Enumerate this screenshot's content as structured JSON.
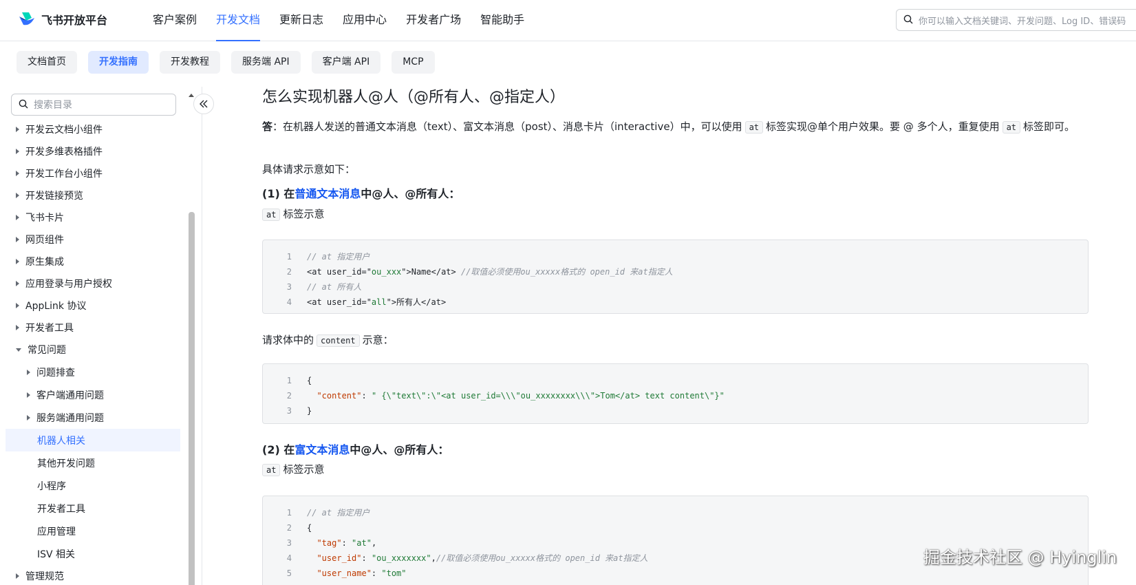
{
  "header": {
    "logo_text": "飞书开放平台",
    "nav": [
      "客户案例",
      "开发文档",
      "更新日志",
      "应用中心",
      "开发者广场",
      "智能助手"
    ],
    "active_nav": "开发文档",
    "search_placeholder": "你可以输入文档关键词、开发问题、Log ID、错误码"
  },
  "subnav": [
    "文档首页",
    "开发指南",
    "开发教程",
    "服务端 API",
    "客户端 API",
    "MCP"
  ],
  "subnav_active": "开发指南",
  "sidebar": {
    "search_placeholder": "搜索目录",
    "items": [
      {
        "label": "开发云文档小组件",
        "level": 1,
        "caret": "right"
      },
      {
        "label": "开发多维表格插件",
        "level": 1,
        "caret": "right"
      },
      {
        "label": "开发工作台小组件",
        "level": 1,
        "caret": "right"
      },
      {
        "label": "开发链接预览",
        "level": 1,
        "caret": "right"
      },
      {
        "label": "飞书卡片",
        "level": 1,
        "caret": "right"
      },
      {
        "label": "网页组件",
        "level": 1,
        "caret": "right"
      },
      {
        "label": "原生集成",
        "level": 1,
        "caret": "right"
      },
      {
        "label": "应用登录与用户授权",
        "level": 1,
        "caret": "right"
      },
      {
        "label": "AppLink 协议",
        "level": 1,
        "caret": "right"
      },
      {
        "label": "开发者工具",
        "level": 1,
        "caret": "right"
      },
      {
        "label": "常见问题",
        "level": 1,
        "caret": "down"
      },
      {
        "label": "问题排查",
        "level": 2,
        "caret": "right"
      },
      {
        "label": "客户端通用问题",
        "level": 2,
        "caret": "right"
      },
      {
        "label": "服务端通用问题",
        "level": 2,
        "caret": "right"
      },
      {
        "label": "机器人相关",
        "level": 2,
        "caret": "none",
        "selected": true
      },
      {
        "label": "其他开发问题",
        "level": 2,
        "caret": "none"
      },
      {
        "label": "小程序",
        "level": 2,
        "caret": "none"
      },
      {
        "label": "开发者工具",
        "level": 2,
        "caret": "none"
      },
      {
        "label": "应用管理",
        "level": 2,
        "caret": "none"
      },
      {
        "label": "ISV 相关",
        "level": 2,
        "caret": "none"
      },
      {
        "label": "管理规范",
        "level": 1,
        "caret": "right"
      }
    ]
  },
  "content": {
    "title": "怎么实现机器人@人（@所有人、@指定人）",
    "answer_label": "答",
    "answer_text_1": "：在机器人发送的普通文本消息（text）、富文本消息（post）、消息卡片（interactive）中，可以使用",
    "answer_code_1": "at",
    "answer_text_2": "标签实现@单个用户效果。要 @ 多个人，重复使用",
    "answer_code_2": "at",
    "answer_text_3": "标签即可。",
    "example_intro": "具体请求示意如下：",
    "section1_prefix": "(1) 在",
    "section1_link": "普通文本消息",
    "section1_suffix": "中@人、@所有人：",
    "tag_code": "at",
    "tag_desc": "标签示意",
    "code1": [
      {
        "n": "1",
        "text": "// at 指定用户"
      },
      {
        "n": "2",
        "a": "<at user_id=\"",
        "b": "ou_xxx",
        "c": "\">Name</at> ",
        "d": "//取值必须使用ou_xxxxx格式的 open_id 来at指定人"
      },
      {
        "n": "3",
        "text": "// at 所有人"
      },
      {
        "n": "4",
        "a": "<at user_id=\"",
        "b": "all",
        "c": "\">所有人</at>",
        "d": ""
      }
    ],
    "request_body_prefix": "请求体中的",
    "request_body_code": "content",
    "request_body_suffix": "示意：",
    "code2": [
      {
        "n": "1",
        "text": "{"
      },
      {
        "n": "2",
        "k": "  \"content\"",
        "sep": ": ",
        "v": "\" {\\\"text\\\":\\\"<at user_id=\\\\\\\"ou_xxxxxxxx\\\\\\\">Tom</at> text content\\\"}\""
      },
      {
        "n": "3",
        "text": "}"
      }
    ],
    "section2_prefix": "(2) 在",
    "section2_link": "富文本消息",
    "section2_suffix": "中@人、@所有人：",
    "tag_code_2": "at",
    "tag_desc_2": "标签示意",
    "code3": [
      {
        "n": "1",
        "text": "// at 指定用户"
      },
      {
        "n": "2",
        "text": "{"
      },
      {
        "n": "3",
        "k": "  \"tag\"",
        "sep": ": ",
        "v": "\"at\"",
        "tail": ","
      },
      {
        "n": "4",
        "k": "  \"user_id\"",
        "sep": ": ",
        "v": "\"ou_xxxxxxx\"",
        "tail": ",//取值必须使用ou_xxxxx格式的 open_id 来at指定人"
      },
      {
        "n": "5",
        "k": "  \"user_name\"",
        "sep": ": ",
        "v": "\"tom\"",
        "tail": ""
      }
    ]
  },
  "watermark": "掘金技术社区 @ Hyinglin"
}
